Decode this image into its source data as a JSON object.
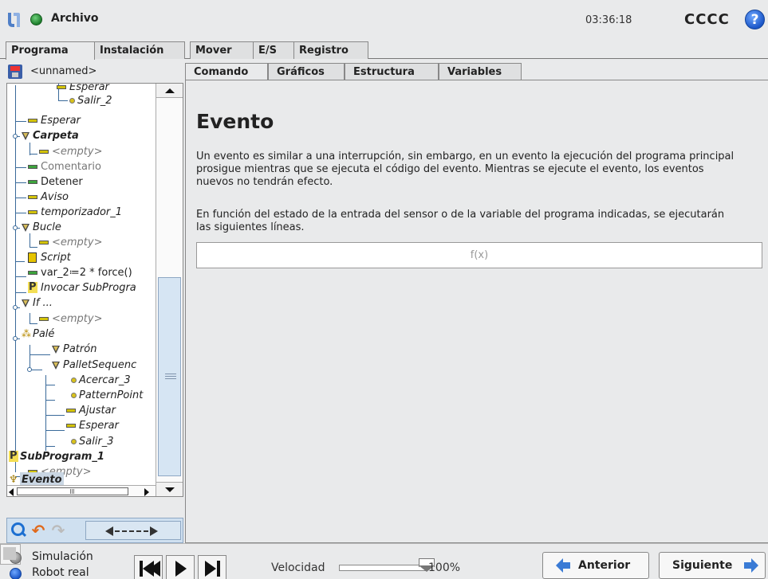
{
  "app": {
    "menu_label": "Archivo",
    "clock": "03:36:18",
    "robot_name": "CCCC",
    "help_glyph": "?"
  },
  "main_tabs": [
    "Programa",
    "Instalación",
    "Mover",
    "E/S",
    "Registro"
  ],
  "program": {
    "name": "<unnamed>"
  },
  "tree": [
    {
      "label": "Esperar",
      "icon": "wait-icon"
    },
    {
      "label": "Salir_2",
      "icon": "waypoint-icon"
    },
    {
      "label": "Esperar",
      "icon": "wait-icon"
    },
    {
      "label": "Carpeta",
      "icon": "folder-icon"
    },
    {
      "label": "<empty>",
      "icon": "wait-icon"
    },
    {
      "label": "Comentario",
      "icon": "wait-icon"
    },
    {
      "label": "Detener",
      "icon": "wait-icon"
    },
    {
      "label": "Aviso",
      "icon": "wait-icon"
    },
    {
      "label": "temporizador_1",
      "icon": "wait-icon"
    },
    {
      "label": "Bucle",
      "icon": "loop-icon"
    },
    {
      "label": "<empty>",
      "icon": "wait-icon"
    },
    {
      "label": "Script",
      "icon": "script-icon"
    },
    {
      "label": "var_2≔2 * force()",
      "icon": "wait-icon"
    },
    {
      "label": "Invocar SubProgra",
      "icon": "subprogram-icon"
    },
    {
      "label": "If ...",
      "icon": "if-icon"
    },
    {
      "label": "<empty>",
      "icon": "wait-icon"
    },
    {
      "label": "Palé",
      "icon": "pallet-icon"
    },
    {
      "label": "Patrón",
      "icon": "pattern-icon"
    },
    {
      "label": "PalletSequenc",
      "icon": "sequence-icon"
    },
    {
      "label": "Acercar_3",
      "icon": "waypoint-icon"
    },
    {
      "label": "PatternPoint",
      "icon": "waypoint-icon"
    },
    {
      "label": "Ajustar",
      "icon": "wait-icon"
    },
    {
      "label": "Esperar",
      "icon": "wait-icon"
    },
    {
      "label": "Salir_3",
      "icon": "waypoint-icon"
    },
    {
      "label": "SubProgram_1",
      "icon": "subprogram-icon"
    },
    {
      "label": "<empty>",
      "icon": "wait-icon"
    },
    {
      "label": "Evento",
      "icon": "event-icon"
    }
  ],
  "sub_tabs": [
    "Comando",
    "Gráficos",
    "Estructura",
    "Variables"
  ],
  "event": {
    "title": "Evento",
    "para1": "Un evento es similar a una interrupción, sin embargo, en un evento la ejecución del programa principal prosigue mientras que se ejecuta el código del evento. Mientras se ejecute el evento, los eventos nuevos no tendrán efecto.",
    "para2": "En función del estado de la entrada del sensor o de la variable del programa indicadas, se ejecutarán las siguientes líneas.",
    "expression_placeholder": "f(x)"
  },
  "bottom": {
    "mode_sim": "Simulación",
    "mode_real": "Robot real",
    "speed_label": "Velocidad",
    "speed_value": "100%",
    "speed_fraction": 1.0,
    "prev_label": "Anterior",
    "next_label": "Siguiente"
  },
  "colors": {
    "accent": "#3a7bd5",
    "selection": "#c9d6e3",
    "status_green": "#1c7d2b"
  }
}
